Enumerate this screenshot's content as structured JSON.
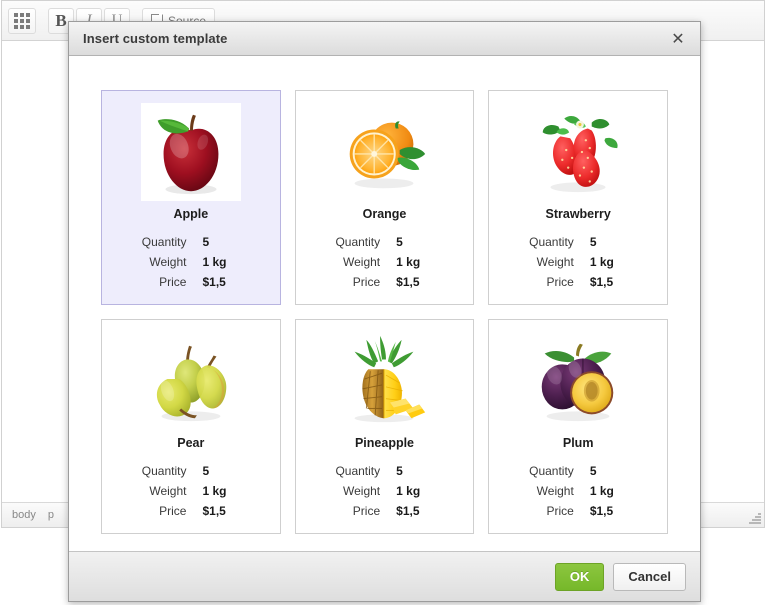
{
  "editor": {
    "toolbar": {
      "buttons": [
        {
          "name": "templates",
          "label": "",
          "icon": "grid-icon",
          "title": "Templates"
        },
        {
          "name": "bold",
          "label": "B",
          "icon": "bold-icon",
          "title": "Bold"
        },
        {
          "name": "italic",
          "label": "I",
          "icon": "italic-icon",
          "title": "Italic"
        },
        {
          "name": "underline",
          "label": "U",
          "icon": "underline-icon",
          "title": "Underline"
        },
        {
          "name": "source",
          "label": "Source",
          "icon": "page-icon",
          "title": "Source"
        }
      ]
    },
    "statusbar": {
      "elements_path": [
        "body",
        "p"
      ]
    }
  },
  "dialog": {
    "title": "Insert custom template",
    "close_label": "✕",
    "footer": {
      "ok_label": "OK",
      "cancel_label": "Cancel"
    },
    "selected_index": 0,
    "spec_labels": {
      "quantity": "Quantity",
      "weight": "Weight",
      "price": "Price"
    },
    "templates": [
      {
        "name": "Apple",
        "image": "apple-image",
        "selected": true,
        "quantity": "5",
        "weight": "1 kg",
        "price": "$1,5"
      },
      {
        "name": "Orange",
        "image": "orange-image",
        "selected": false,
        "quantity": "5",
        "weight": "1 kg",
        "price": "$1,5"
      },
      {
        "name": "Strawberry",
        "image": "strawberry-image",
        "selected": false,
        "quantity": "5",
        "weight": "1 kg",
        "price": "$1,5"
      },
      {
        "name": "Pear",
        "image": "pear-image",
        "selected": false,
        "quantity": "5",
        "weight": "1 kg",
        "price": "$1,5"
      },
      {
        "name": "Pineapple",
        "image": "pineapple-image",
        "selected": false,
        "quantity": "5",
        "weight": "1 kg",
        "price": "$1,5"
      },
      {
        "name": "Plum",
        "image": "plum-image",
        "selected": false,
        "quantity": "5",
        "weight": "1 kg",
        "price": "$1,5"
      }
    ]
  },
  "colors": {
    "accent_ok": "#76b82a",
    "selection_bg": "#eeedfc",
    "selection_border": "#b8b4e0",
    "dialog_border": "#9c9c9c"
  }
}
